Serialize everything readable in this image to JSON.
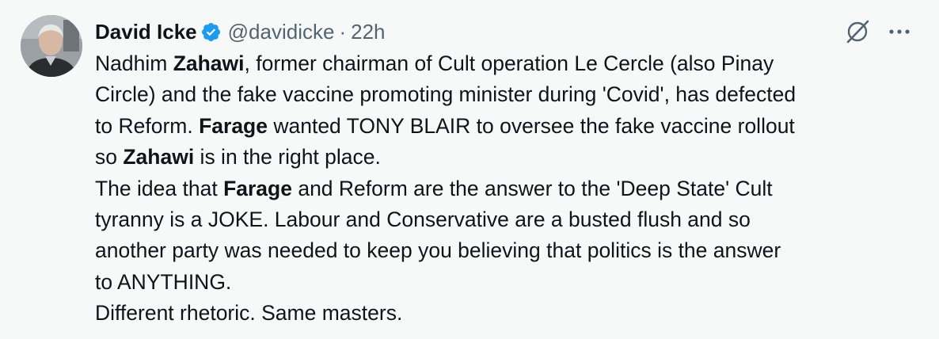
{
  "author": {
    "display_name": "David Icke",
    "handle": "@davidicke",
    "separator": "·",
    "time": "22h",
    "verified": true,
    "verified_color": "#1d9bf0"
  },
  "icons": {
    "verified": "verified-badge-icon",
    "grok": "grok-icon",
    "more": "more-options-icon"
  },
  "tweet": {
    "lines": [
      [
        "Nadhim ",
        "Zahawi",
        ", former chairman of Cult operation Le Cercle (also Pinay"
      ],
      [
        "Circle) and the fake vaccine promoting minister during 'Covid', has defected"
      ],
      [
        "to Reform. ",
        "Farage",
        " wanted TONY BLAIR to oversee the fake vaccine rollout"
      ],
      [
        "so ",
        "Zahawi",
        " is in the right place."
      ],
      [
        "The idea that ",
        "Farage",
        " and Reform are the answer to the 'Deep State' Cult"
      ],
      [
        "tyranny is a JOKE. Labour and Conservative are a busted flush and so"
      ],
      [
        "another party was needed to keep you believing that politics is the answer"
      ],
      [
        "to ANYTHING."
      ],
      [
        "Different rhetoric. Same masters."
      ]
    ]
  },
  "colors": {
    "background": "#f7f9f9",
    "text": "#0f1419",
    "muted": "#536471"
  }
}
